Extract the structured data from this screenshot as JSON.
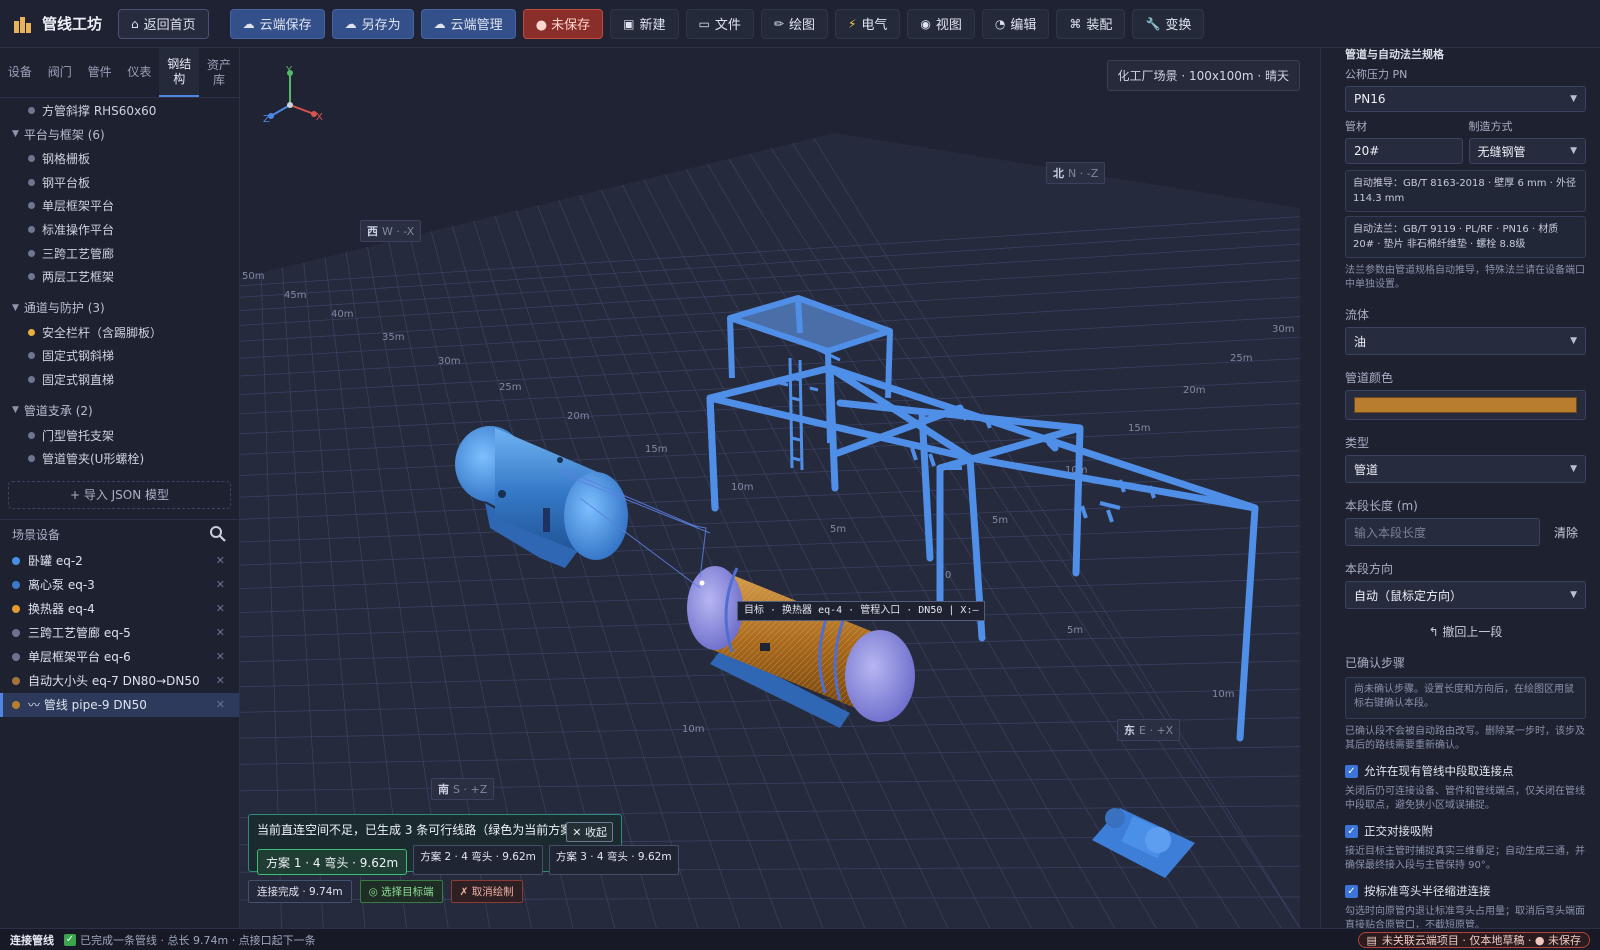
{
  "app": {
    "title": "管线工坊"
  },
  "toolbar": {
    "home": "返回首页",
    "cloud_save": "云端保存",
    "save_as": "另存为",
    "cloud_manage": "云端管理",
    "unsaved": "● 未保存",
    "new": "新建",
    "file": "文件",
    "draw": "绘图",
    "electric": "电气",
    "view": "视图",
    "edit": "编辑",
    "assemble": "装配",
    "transform": "变换"
  },
  "left": {
    "tabs": [
      "设备",
      "阀门",
      "管件",
      "仪表",
      "钢结构",
      "资产库"
    ],
    "active_tab": 4,
    "top_item": "方管斜撑 RHS60x60",
    "groups": [
      {
        "label": "平台与框架 (6)",
        "items": [
          "钢格栅板",
          "钢平台板",
          "单层框架平台",
          "标准操作平台",
          "三跨工艺管廊",
          "两层工艺框架"
        ]
      },
      {
        "label": "通道与防护 (3)",
        "items": [
          "安全栏杆（含踢脚板）",
          "固定式钢斜梯",
          "固定式钢直梯"
        ]
      },
      {
        "label": "管道支承 (2)",
        "items": [
          "门型管托支架",
          "管道管夹(U形螺栓)"
        ]
      }
    ],
    "import_label": "+ 导入 JSON 模型",
    "scene_title": "场景设备",
    "scene_items": [
      {
        "label": "卧罐 eq-2",
        "color": "#4a8fe6"
      },
      {
        "label": "离心泵 eq-3",
        "color": "#3e78c9"
      },
      {
        "label": "换热器 eq-4",
        "color": "#e49a2c"
      },
      {
        "label": "三跨工艺管廊 eq-5",
        "color": "#6b7390"
      },
      {
        "label": "单层框架平台 eq-6",
        "color": "#6b7390"
      },
      {
        "label": "自动大小头 eq-7 DN80→DN50",
        "color": "#a3733c"
      },
      {
        "label": "〰 管线 pipe-9 DN50",
        "color": "#b87d2e"
      }
    ]
  },
  "viewport": {
    "scene_tag": "化工厂场景 · 100x100m · 晴天",
    "compass": {
      "north": "北",
      "north_sub": "N · -Z",
      "west": "西",
      "west_sub": "W · -X",
      "east": "东",
      "east_sub": "E · +X",
      "south": "南",
      "south_sub": "S · +Z"
    },
    "axes": {
      "x": "X",
      "y": "Y",
      "z": "Z"
    },
    "ruler_left": [
      "50m",
      "45m",
      "40m",
      "35m",
      "30m",
      "25m",
      "20m",
      "15m",
      "10m",
      "5m",
      "0"
    ],
    "ruler_right": [
      "30m",
      "25m",
      "20m",
      "15m",
      "10m",
      "5m",
      "5m",
      "10m"
    ],
    "ruler_front": [
      "10m",
      "5m"
    ],
    "target_tip": "目标 · 换热器 eq-4 · 管程入口 · DN50 | X:—",
    "route_msg": "当前直连空间不足，已生成 3 条可行线路（绿色为当前方案）",
    "collapse": "✕ 收起",
    "plans": [
      "方案 1 · 4 弯头 · 9.62m",
      "方案 2 · 4 弯头 · 9.62m",
      "方案 3 · 4 弯头 · 9.62m"
    ],
    "actions": {
      "done": "连接完成 · 9.74m",
      "select_target": "◎ 选择目标端",
      "cancel": "✗ 取消绘制"
    }
  },
  "right": {
    "section": "管道与自动法兰规格",
    "pn_label": "公称压力 PN",
    "pn_value": "PN16",
    "material_label": "管材",
    "material_value": "20#",
    "method_label": "制造方式",
    "method_value": "无缝钢管",
    "auto_pipe": "自动推导：GB/T 8163-2018 · 壁厚 6 mm · 外径 114.3 mm",
    "auto_flange": "自动法兰：GB/T 9119 · PL/RF · PN16 · 材质 20# · 垫片 非石棉纤维垫 · 螺栓 8.8级",
    "flange_note": "法兰参数由管道规格自动推导，特殊法兰请在设备端口中单独设置。",
    "fluid_label": "流体",
    "fluid_value": "油",
    "color_label": "管道颜色",
    "pipe_color": "#b87d2e",
    "type_label": "类型",
    "type_value": "管道",
    "len_label": "本段长度 (m)",
    "len_placeholder": "输入本段长度",
    "clear": "清除",
    "dir_label": "本段方向",
    "dir_value": "自动（鼠标定方向）",
    "undo": "↰ 撤回上一段",
    "steps_label": "已确认步骤",
    "steps_empty": "尚未确认步骤。设置长度和方向后，在绘图区用鼠标右键确认本段。",
    "steps_note": "已确认段不会被自动路由改写。删除某一步时，该步及其后的路线需要重新确认。",
    "cb1": "允许在现有管线中段取连接点",
    "cb1_note": "关闭后仍可连接设备、管件和管线端点，仅关闭在管线中段取点，避免狭小区域误捕捉。",
    "cb2": "正交对接吸附",
    "cb2_note": "接近目标主管时捕捉真实三维垂足；自动生成三通，并确保最终接入段与主管保持 90°。",
    "cb3": "按标准弯头半径缩进连接",
    "cb3_note": "勾选时向原管内退让标准弯头占用量；取消后弯头端面直接贴合原管口，不截短原管。"
  },
  "status": {
    "mode": "连接管线",
    "message": "已完成一条管线 · 总长 9.74m · 点接口起下一条",
    "cloud": "未关联云端项目 · 仅本地草稿 · ● 未保存"
  }
}
